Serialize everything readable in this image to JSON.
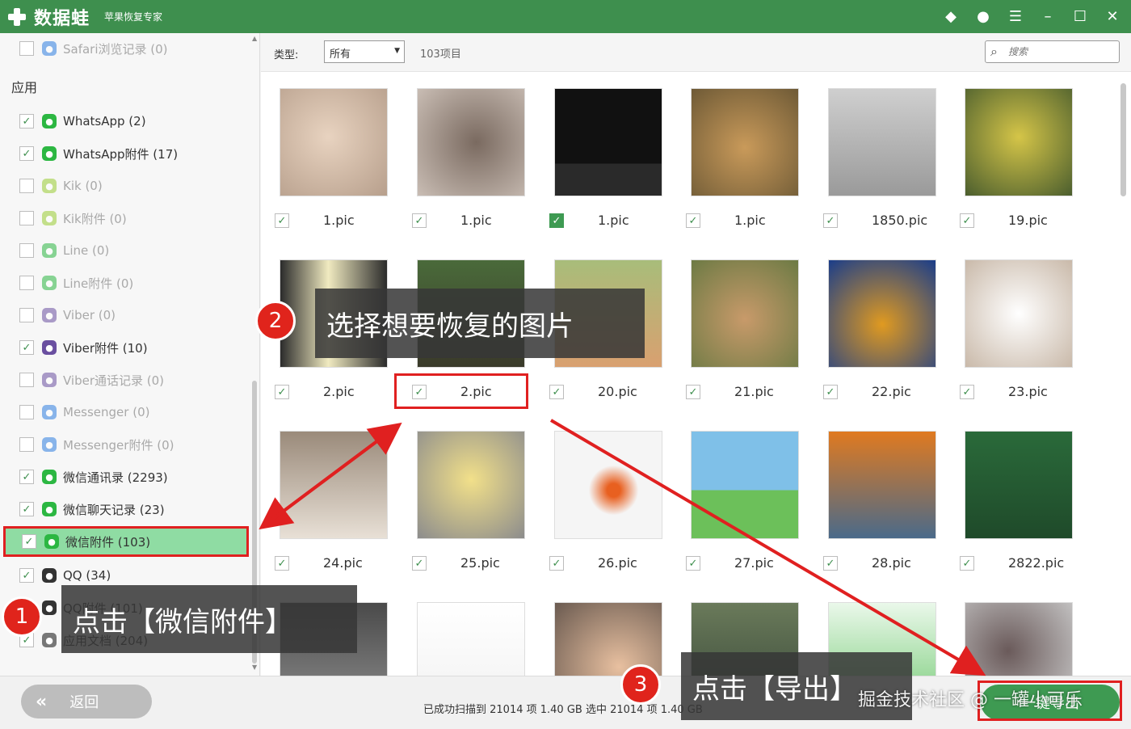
{
  "app": {
    "name": "数据蛙",
    "subtitle": "苹果恢复专家",
    "colors": {
      "brand": "#3e8f4e",
      "highlight": "#8fdca3",
      "annotation": "#e02020"
    }
  },
  "window_controls": [
    "diamond-icon",
    "chat-icon",
    "notes-icon",
    "minimize-icon",
    "maximize-icon",
    "close-icon"
  ],
  "sidebar": {
    "section_label": "应用",
    "items": [
      {
        "label": "Safari浏览记录 (0)",
        "checked": false,
        "icon": "safari-icon"
      },
      {
        "label": "WhatsApp (2)",
        "checked": true,
        "icon": "whatsapp-icon"
      },
      {
        "label": "WhatsApp附件 (17)",
        "checked": true,
        "icon": "whatsapp-icon"
      },
      {
        "label": "Kik (0)",
        "checked": false,
        "icon": "kik-icon"
      },
      {
        "label": "Kik附件 (0)",
        "checked": false,
        "icon": "kik-icon"
      },
      {
        "label": "Line (0)",
        "checked": false,
        "icon": "line-icon"
      },
      {
        "label": "Line附件 (0)",
        "checked": false,
        "icon": "line-icon"
      },
      {
        "label": "Viber (0)",
        "checked": false,
        "icon": "viber-icon"
      },
      {
        "label": "Viber附件 (10)",
        "checked": true,
        "icon": "viber-icon"
      },
      {
        "label": "Viber通话记录 (0)",
        "checked": false,
        "icon": "viber-icon"
      },
      {
        "label": "Messenger (0)",
        "checked": false,
        "icon": "messenger-icon"
      },
      {
        "label": "Messenger附件 (0)",
        "checked": false,
        "icon": "messenger-icon"
      },
      {
        "label": "微信通讯录 (2293)",
        "checked": true,
        "icon": "wechat-icon"
      },
      {
        "label": "微信聊天记录 (23)",
        "checked": true,
        "icon": "wechat-icon"
      },
      {
        "label": "微信附件 (103)",
        "checked": true,
        "icon": "wechat-icon"
      },
      {
        "label": "QQ (34)",
        "checked": true,
        "icon": "qq-icon"
      },
      {
        "label": "QQ附件 (101)",
        "checked": true,
        "icon": "qq-icon"
      },
      {
        "label": "应用文档 (204)",
        "checked": true,
        "icon": "documents-icon"
      }
    ]
  },
  "toolbar": {
    "type_label": "类型:",
    "type_value": "所有",
    "item_count": "103项目",
    "search_placeholder": "搜索"
  },
  "grid": [
    {
      "name": "1.pic",
      "checked": true,
      "thumb": "blurred-portrait"
    },
    {
      "name": "1.pic",
      "checked": true,
      "thumb": "blurred-face"
    },
    {
      "name": "1.pic",
      "checked": true,
      "thumb": "phone-screenshot"
    },
    {
      "name": "1.pic",
      "checked": true,
      "thumb": "dog-with-butterfly"
    },
    {
      "name": "1850.pic",
      "checked": true,
      "thumb": "wall-plaque"
    },
    {
      "name": "19.pic",
      "checked": true,
      "thumb": "bird-on-branch"
    },
    {
      "name": "2.pic",
      "checked": true,
      "thumb": "drink-photo"
    },
    {
      "name": "2.pic",
      "checked": true,
      "thumb": "tree-photo"
    },
    {
      "name": "20.pic",
      "checked": true,
      "thumb": "dog-outdoors"
    },
    {
      "name": "21.pic",
      "checked": true,
      "thumb": "fox"
    },
    {
      "name": "22.pic",
      "checked": true,
      "thumb": "hamster-on-pumpkin"
    },
    {
      "name": "23.pic",
      "checked": true,
      "thumb": "papillon-dog"
    },
    {
      "name": "24.pic",
      "checked": true,
      "thumb": "cats"
    },
    {
      "name": "25.pic",
      "checked": true,
      "thumb": "chick"
    },
    {
      "name": "26.pic",
      "checked": true,
      "thumb": "goldfish"
    },
    {
      "name": "27.pic",
      "checked": true,
      "thumb": "cartoon-pigs"
    },
    {
      "name": "28.pic",
      "checked": true,
      "thumb": "autumn-lake"
    },
    {
      "name": "2822.pic",
      "checked": true,
      "thumb": "green-poster"
    },
    {
      "name": "",
      "checked": true,
      "thumb": "dark-photo"
    },
    {
      "name": "",
      "checked": true,
      "thumb": "chat-screenshot"
    },
    {
      "name": "",
      "checked": true,
      "thumb": "hand"
    },
    {
      "name": "",
      "checked": true,
      "thumb": "trees"
    },
    {
      "name": "",
      "checked": true,
      "thumb": "green-screen"
    },
    {
      "name": "",
      "checked": true,
      "thumb": "blurred-person"
    }
  ],
  "bottom": {
    "back_label": "返回",
    "status": "已成功扫描到 21014 项 1.40 GB  选中 21014 项 1.40 GB",
    "export_label": "一键导出"
  },
  "annotations": {
    "step1_number": "1",
    "step1_text": "点击【微信附件】",
    "step2_number": "2",
    "step2_text": "选择想要恢复的图片",
    "step3_number": "3",
    "step3_text": "点击【导出】"
  },
  "watermark": "掘金技术社区 @ 一罐小可乐"
}
